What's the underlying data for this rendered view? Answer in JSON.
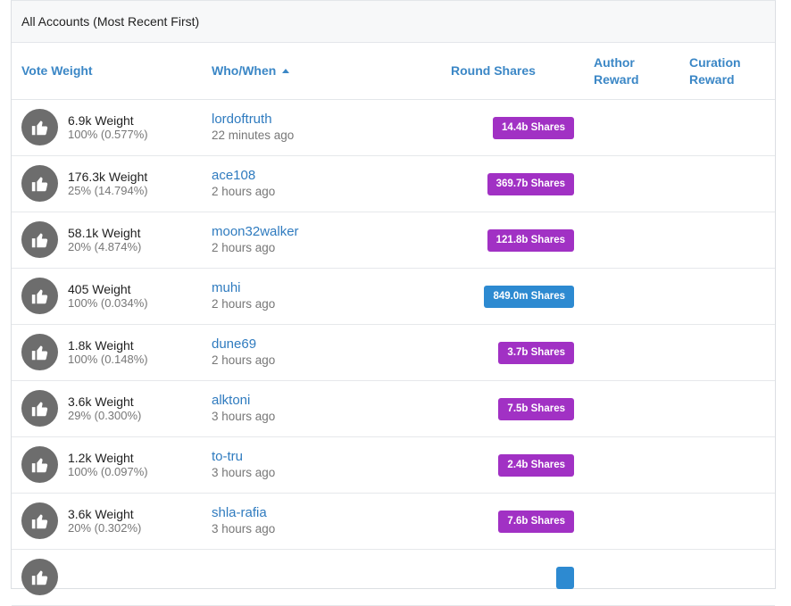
{
  "panel_title": "All Accounts (Most Recent First)",
  "columns": {
    "vote_weight": "Vote Weight",
    "who_when": "Who/When",
    "round_shares": "Round Shares",
    "author_reward": "Author Reward",
    "curation_reward": "Curation Reward"
  },
  "colors": {
    "purple_badge": "#a131c4",
    "blue_badge": "#2d8ad1",
    "link": "#2f7bbf"
  },
  "rows": [
    {
      "weight": "6.9k Weight",
      "pct": "100% (0.577%)",
      "who": "lordoftruth",
      "when": "22 minutes ago",
      "shares": "14.4b Shares",
      "badge": "purple"
    },
    {
      "weight": "176.3k Weight",
      "pct": "25% (14.794%)",
      "who": "ace108",
      "when": "2 hours ago",
      "shares": "369.7b Shares",
      "badge": "purple"
    },
    {
      "weight": "58.1k Weight",
      "pct": "20% (4.874%)",
      "who": "moon32walker",
      "when": "2 hours ago",
      "shares": "121.8b Shares",
      "badge": "purple"
    },
    {
      "weight": "405 Weight",
      "pct": "100% (0.034%)",
      "who": "muhi",
      "when": "2 hours ago",
      "shares": "849.0m Shares",
      "badge": "blue"
    },
    {
      "weight": "1.8k Weight",
      "pct": "100% (0.148%)",
      "who": "dune69",
      "when": "2 hours ago",
      "shares": "3.7b Shares",
      "badge": "purple"
    },
    {
      "weight": "3.6k Weight",
      "pct": "29% (0.300%)",
      "who": "alktoni",
      "when": "3 hours ago",
      "shares": "7.5b Shares",
      "badge": "purple"
    },
    {
      "weight": "1.2k Weight",
      "pct": "100% (0.097%)",
      "who": "to-tru",
      "when": "3 hours ago",
      "shares": "2.4b Shares",
      "badge": "purple"
    },
    {
      "weight": "3.6k Weight",
      "pct": "20% (0.302%)",
      "who": "shla-rafia",
      "when": "3 hours ago",
      "shares": "7.6b Shares",
      "badge": "purple"
    },
    {
      "weight": "",
      "pct": "",
      "who": "",
      "when": "",
      "shares": "",
      "badge": "blue"
    }
  ],
  "icons": {
    "vote": "thumbs-up-icon",
    "sort": "sort-ascending-icon"
  }
}
